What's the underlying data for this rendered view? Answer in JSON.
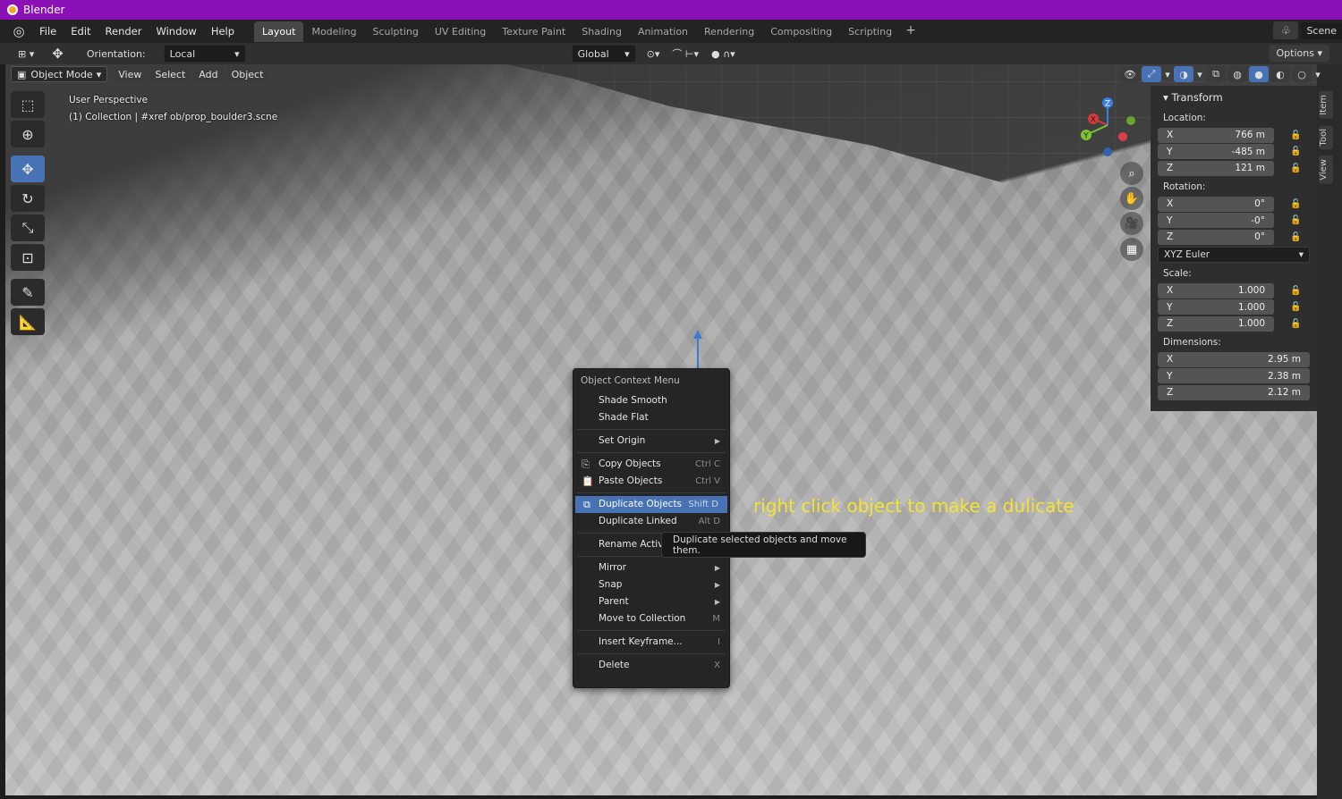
{
  "window": {
    "title": "Blender"
  },
  "menubar": {
    "items": [
      "File",
      "Edit",
      "Render",
      "Window",
      "Help"
    ],
    "workspaces": [
      "Layout",
      "Modeling",
      "Sculpting",
      "UV Editing",
      "Texture Paint",
      "Shading",
      "Animation",
      "Rendering",
      "Compositing",
      "Scripting"
    ],
    "active_workspace": "Layout",
    "add_tab": "+",
    "scene": "Scene"
  },
  "tool_header": {
    "orientation_label": "Orientation:",
    "orientation_value": "Local",
    "transform_orientation": "Global",
    "options": "Options"
  },
  "viewport_header": {
    "mode": "Object Mode",
    "menus": [
      "View",
      "Select",
      "Add",
      "Object"
    ]
  },
  "viewport_info": {
    "perspective": "User Perspective",
    "collection": "(1) Collection | #xref ob/prop_boulder3.scne"
  },
  "gizmo": {
    "z": "Z",
    "x": "X",
    "y": "Y"
  },
  "side_tabs": [
    "Item",
    "Tool",
    "View"
  ],
  "transform_panel": {
    "title": "Transform",
    "location_label": "Location:",
    "location": [
      {
        "axis": "X",
        "value": "766 m"
      },
      {
        "axis": "Y",
        "value": "-485 m"
      },
      {
        "axis": "Z",
        "value": "121 m"
      }
    ],
    "rotation_label": "Rotation:",
    "rotation": [
      {
        "axis": "X",
        "value": "0°"
      },
      {
        "axis": "Y",
        "value": "-0°"
      },
      {
        "axis": "Z",
        "value": "0°"
      }
    ],
    "rotation_mode": "XYZ Euler",
    "scale_label": "Scale:",
    "scale": [
      {
        "axis": "X",
        "value": "1.000"
      },
      {
        "axis": "Y",
        "value": "1.000"
      },
      {
        "axis": "Z",
        "value": "1.000"
      }
    ],
    "dimensions_label": "Dimensions:",
    "dimensions": [
      {
        "axis": "X",
        "value": "2.95 m"
      },
      {
        "axis": "Y",
        "value": "2.38 m"
      },
      {
        "axis": "Z",
        "value": "2.12 m"
      }
    ]
  },
  "context_menu": {
    "title": "Object Context Menu",
    "shade_smooth": "Shade Smooth",
    "shade_flat": "Shade Flat",
    "set_origin": "Set Origin",
    "copy_objects": "Copy Objects",
    "copy_shortcut": "Ctrl C",
    "paste_objects": "Paste Objects",
    "paste_shortcut": "Ctrl V",
    "duplicate_objects": "Duplicate Objects",
    "duplicate_shortcut": "Shift D",
    "duplicate_linked": "Duplicate Linked",
    "duplicate_linked_shortcut": "Alt D",
    "rename_active": "Rename Active",
    "mirror": "Mirror",
    "snap": "Snap",
    "parent": "Parent",
    "move_to_collection": "Move to Collection",
    "move_shortcut": "M",
    "insert_keyframe": "Insert Keyframe...",
    "insert_shortcut": "I",
    "delete": "Delete",
    "delete_shortcut": "X"
  },
  "tooltip": "Duplicate selected objects and move them.",
  "annotation": "right click object to make a dulicate",
  "colors": {
    "title_bar": "#8a0fb4",
    "accent": "#4772b3",
    "annotation": "#f5e330"
  }
}
